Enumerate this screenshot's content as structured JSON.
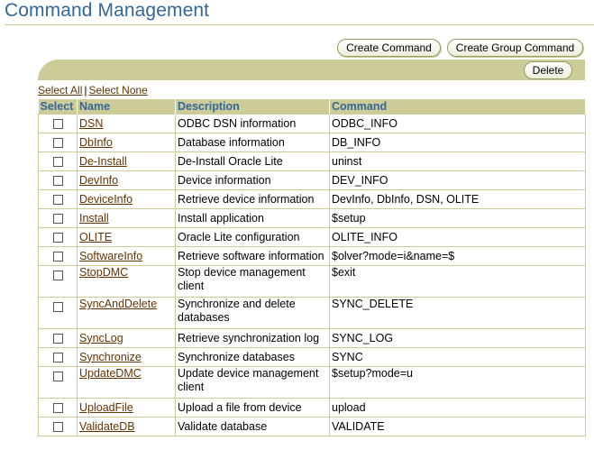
{
  "page": {
    "title": "Command Management"
  },
  "buttons": {
    "create": "Create Command",
    "create_group": "Create Group Command",
    "delete": "Delete"
  },
  "selection": {
    "all": "Select All",
    "separator": "|",
    "none": "Select None"
  },
  "table": {
    "headers": {
      "select": "Select",
      "name": "Name",
      "description": "Description",
      "command": "Command"
    },
    "rows": [
      {
        "name": "DSN",
        "description": "ODBC DSN information",
        "command": "ODBC_INFO"
      },
      {
        "name": "DbInfo",
        "description": "Database information",
        "command": "DB_INFO"
      },
      {
        "name": "De-Install",
        "description": "De-Install Oracle Lite",
        "command": "uninst"
      },
      {
        "name": "DevInfo",
        "description": "Device information",
        "command": "DEV_INFO"
      },
      {
        "name": "DeviceInfo",
        "description": "Retrieve device information",
        "command": "DevInfo, DbInfo, DSN, OLITE"
      },
      {
        "name": "Install",
        "description": "Install application",
        "command": "$setup"
      },
      {
        "name": "OLITE",
        "description": "Oracle Lite configuration",
        "command": "OLITE_INFO"
      },
      {
        "name": "SoftwareInfo",
        "description": "Retrieve software information",
        "command": "$olver?mode=i&name=$"
      },
      {
        "name": "StopDMC",
        "description": "Stop device management client",
        "command": "$exit"
      },
      {
        "name": "SyncAndDelete",
        "description": "Synchronize and delete databases",
        "command": "SYNC_DELETE"
      },
      {
        "name": "SyncLog",
        "description": "Retrieve synchronization log",
        "command": "SYNC_LOG"
      },
      {
        "name": "Synchronize",
        "description": "Synchronize databases",
        "command": "SYNC"
      },
      {
        "name": "UpdateDMC",
        "description": "Update device management client",
        "command": "$setup?mode=u"
      },
      {
        "name": "UploadFile",
        "description": "Upload a file from device",
        "command": "upload"
      },
      {
        "name": "ValidateDB",
        "description": "Validate database",
        "command": "VALIDATE"
      }
    ]
  },
  "colors": {
    "accent": "#336699",
    "bar": "#cccc99",
    "link": "#663300"
  }
}
